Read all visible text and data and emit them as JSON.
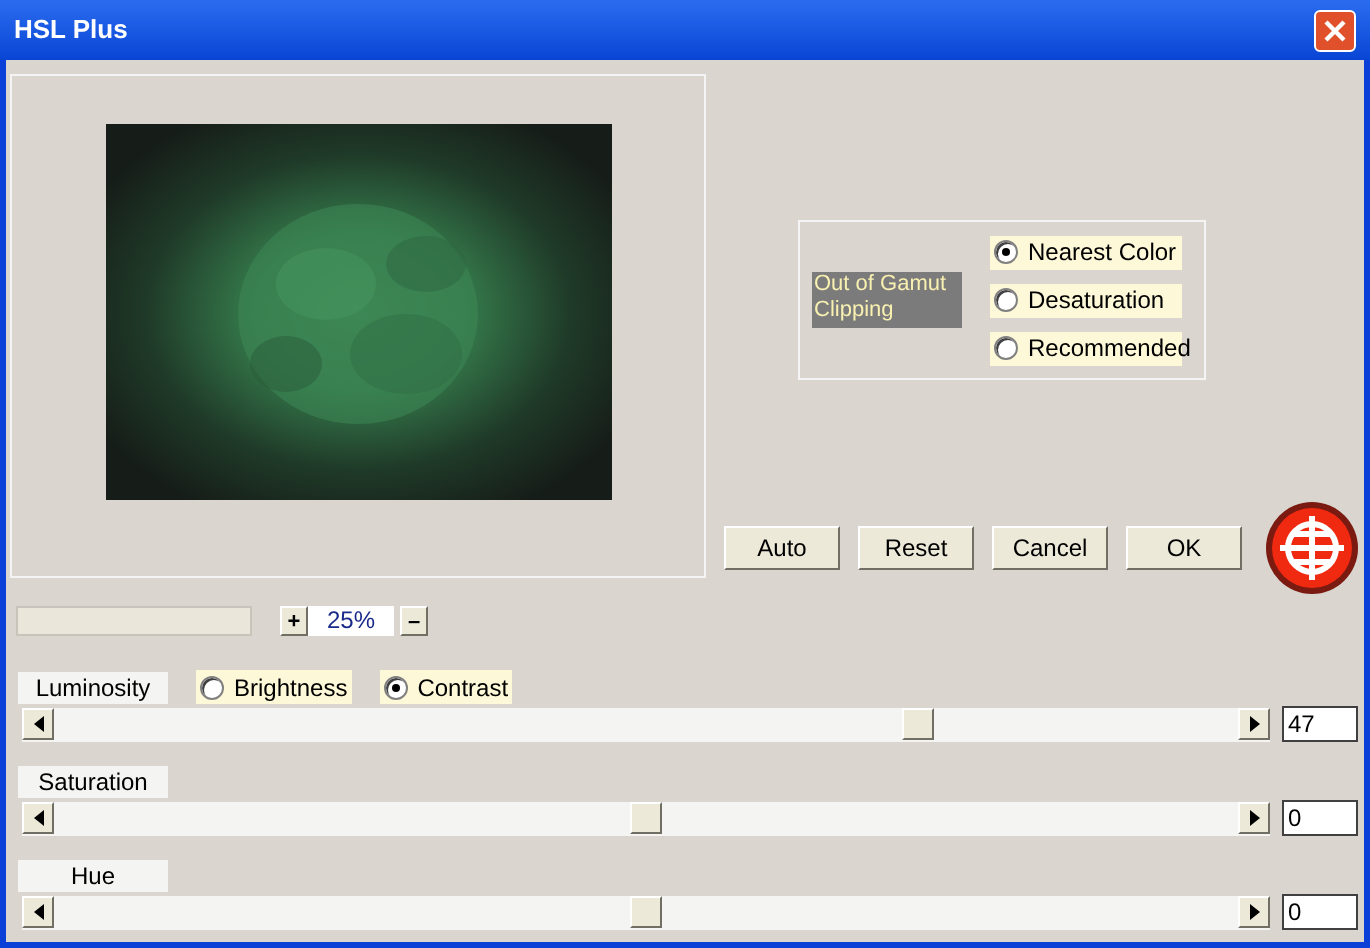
{
  "window": {
    "title": "HSL Plus"
  },
  "zoom": {
    "plus": "+",
    "value": "25%",
    "minus": "–"
  },
  "gamut": {
    "label": "Out of Gamut Clipping",
    "options": [
      {
        "label": "Nearest Color",
        "selected": true
      },
      {
        "label": "Desaturation",
        "selected": false
      },
      {
        "label": "Recommended",
        "selected": false
      }
    ]
  },
  "buttons": [
    "Auto",
    "Reset",
    "Cancel",
    "OK"
  ],
  "sliders": [
    {
      "label": "Luminosity",
      "level": 0.73,
      "value": "47",
      "modes": [
        {
          "label": "Brightness",
          "selected": false
        },
        {
          "label": "Contrast",
          "selected": true
        }
      ]
    },
    {
      "label": "Saturation",
      "level": 0.5,
      "value": "0"
    },
    {
      "label": "Hue",
      "level": 0.5,
      "value": "0"
    }
  ]
}
